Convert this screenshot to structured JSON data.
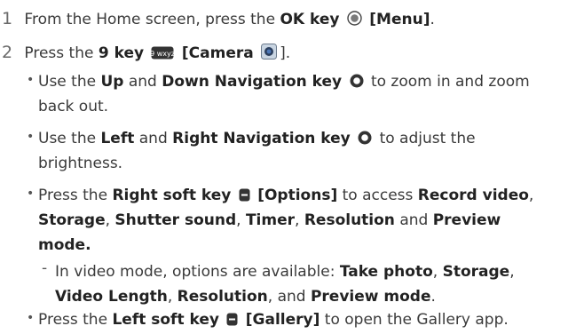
{
  "steps": [
    {
      "number": "1",
      "pre": "From the Home screen, press the ",
      "key": "OK key",
      "label": "[Menu]",
      "post": "."
    },
    {
      "number": "2",
      "pre": "Press the ",
      "key": "9 key",
      "label": "[Camera",
      "post": "]."
    }
  ],
  "bullets": {
    "b1": {
      "pre": "Use the ",
      "k1": "Up",
      "mid": " and ",
      "k2": "Down Navigation key",
      "post1": " to zoom in and zoom",
      "post2": "back out."
    },
    "b2": {
      "pre": "Use the ",
      "k1": "Left",
      "mid": " and ",
      "k2": "Right Navigation key",
      "post1": " to adjust the",
      "post2": "brightness."
    },
    "b3": {
      "pre": "Press the ",
      "k1": "Right soft key",
      "label": "[Options]",
      "mid": " to access ",
      "o1": "Record video",
      "sep1": ",",
      "o2": "Storage",
      "sep2": ", ",
      "o3": "Shutter sound",
      "sep3": ", ",
      "o4": "Timer",
      "sep4": ", ",
      "o5": "Resolution",
      "and": " and ",
      "o6": "Preview",
      "o6b": "mode."
    },
    "sub": {
      "pre": "In video mode, options are available: ",
      "o1": "Take photo",
      "sep1": ", ",
      "o2": "Storage",
      "sep2": ",",
      "o3": "Video Length",
      "sep3": ", ",
      "o4": "Resolution",
      "and": ", and ",
      "o5": "Preview mode",
      "end": "."
    },
    "b4": {
      "pre": "Press the ",
      "k1": "Left soft key",
      "label": "[Gallery]",
      "post": " to open the Gallery app."
    }
  },
  "key_icon_text": "9 wxyz"
}
